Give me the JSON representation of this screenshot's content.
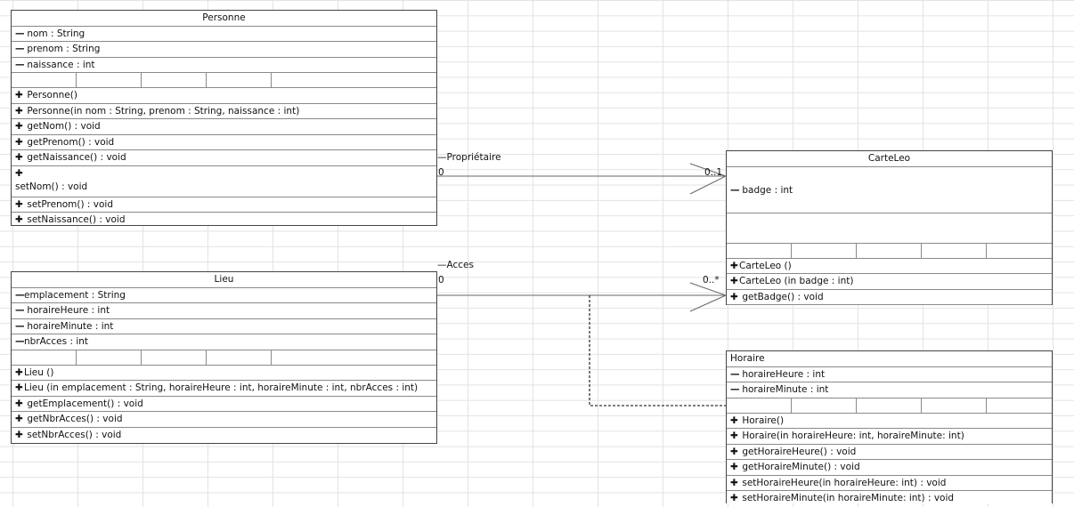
{
  "personne": {
    "name": "Personne",
    "attributes": [
      {
        "vis": "—",
        "text": "nom : String"
      },
      {
        "vis": "—",
        "text": "prenom : String"
      },
      {
        "vis": "—",
        "text": "naissance : int"
      }
    ],
    "methods": [
      {
        "vis": "✚",
        "text": "Personne()"
      },
      {
        "vis": "✚",
        "text": "Personne(in nom : String, prenom : String, naissance : int)"
      },
      {
        "vis": "✚",
        "text": "getNom() : void"
      },
      {
        "vis": "✚",
        "text": "getPrenom() : void"
      },
      {
        "vis": "✚",
        "text": "getNaissance() : void"
      },
      {
        "vis": "✚",
        "text": "setNom() : void"
      },
      {
        "vis": "✚",
        "text": "setPrenom() : void"
      },
      {
        "vis": "✚",
        "text": "setNaissance() : void"
      }
    ]
  },
  "lieu": {
    "name": "Lieu",
    "attributes": [
      {
        "vis": "—",
        "text": "emplacement : String"
      },
      {
        "vis": "—",
        "text": "horaireHeure : int"
      },
      {
        "vis": "—",
        "text": "horaireMinute : int"
      },
      {
        "vis": "—",
        "text": "nbrAcces : int"
      }
    ],
    "methods": [
      {
        "vis": "✚",
        "text": "Lieu ()"
      },
      {
        "vis": "✚",
        "text": "Lieu (in emplacement : String, horaireHeure : int, horaireMinute : int, nbrAcces : int)"
      },
      {
        "vis": "✚",
        "text": "getEmplacement() : void"
      },
      {
        "vis": "✚",
        "text": "getNbrAcces() : void"
      },
      {
        "vis": "✚",
        "text": "setNbrAcces() : void"
      }
    ]
  },
  "carteleo": {
    "name": "CarteLeo",
    "attributes": [
      {
        "vis": "—",
        "text": "badge : int"
      }
    ],
    "methods": [
      {
        "vis": "✚",
        "text": "CarteLeo ()"
      },
      {
        "vis": "✚",
        "text": "CarteLeo (in badge : int)"
      },
      {
        "vis": "✚",
        "text": "getBadge() : void"
      }
    ]
  },
  "horaire": {
    "name": "Horaire",
    "attributes": [
      {
        "vis": "—",
        "text": "horaireHeure : int"
      },
      {
        "vis": "—",
        "text": "horaireMinute : int"
      }
    ],
    "methods": [
      {
        "vis": "✚",
        "text": "Horaire()"
      },
      {
        "vis": "✚",
        "text": "Horaire(in horaireHeure: int, horaireMinute: int)"
      },
      {
        "vis": "✚",
        "text": "getHoraireHeure() : void"
      },
      {
        "vis": "✚",
        "text": "getHoraireMinute() : void"
      },
      {
        "vis": "✚",
        "text": "setHoraireHeure(in horaireHeure: int) : void"
      },
      {
        "vis": "✚",
        "text": "setHoraireMinute(in horaireMinute: int) : void"
      }
    ]
  },
  "associations": {
    "proprietaire": {
      "role": "Propriétaire",
      "source_mult": "0",
      "target_mult": "0..1"
    },
    "acces": {
      "role": "Acces",
      "source_mult": "0",
      "target_mult": "0..*"
    }
  }
}
